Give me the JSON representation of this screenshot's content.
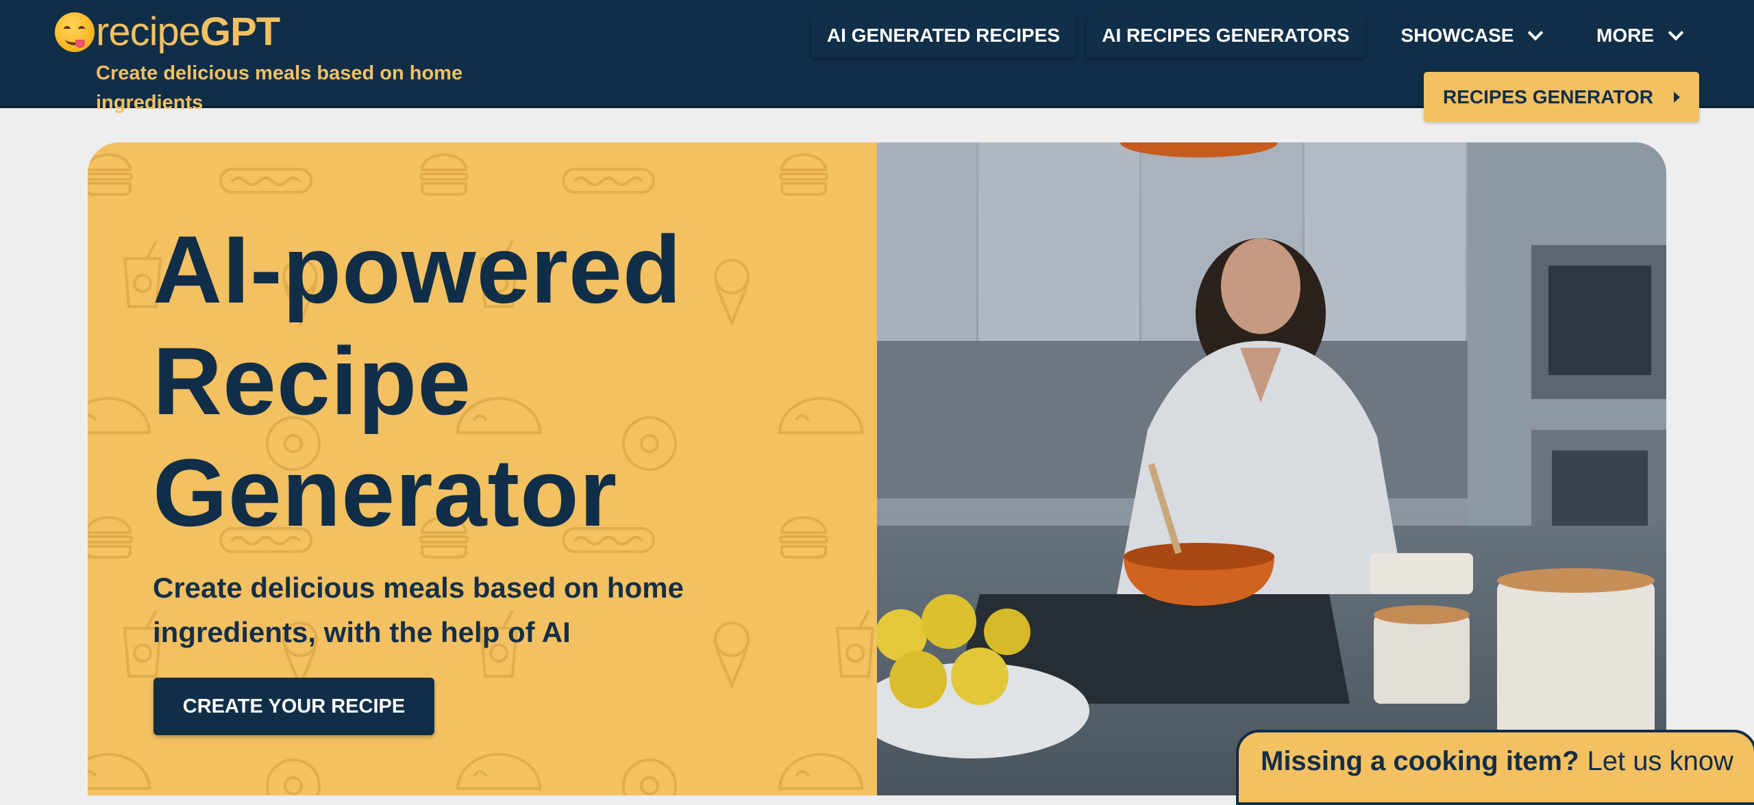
{
  "brand": {
    "logo_prefix": "recipe",
    "logo_suffix": "GPT",
    "tagline": "Create delicious meals based on home ingredients",
    "colors": {
      "navy": "#112e48",
      "yellow": "#f3c062",
      "background": "#eeeeee"
    }
  },
  "nav": {
    "ai_generated_recipes": "AI GENERATED RECIPES",
    "ai_recipes_generators": "AI RECIPES GENERATORS",
    "showcase": "SHOWCASE",
    "more": "MORE",
    "recipes_generator": "RECIPES GENERATOR",
    "icons": [
      "chevron-down-icon",
      "chevron-down-icon",
      "caret-right-icon"
    ]
  },
  "hero": {
    "title_line1": "AI-powered",
    "title_line2": "Recipe",
    "title_line3": "Generator",
    "subtitle": "Create delicious meals based on home ingredients, with the help of AI",
    "cta_label": "CREATE YOUR RECIPE",
    "image_description_icon": "photo-woman-cooking-in-kitchen"
  },
  "feedback": {
    "bold": "Missing a cooking item?",
    "link": "Let us know"
  }
}
